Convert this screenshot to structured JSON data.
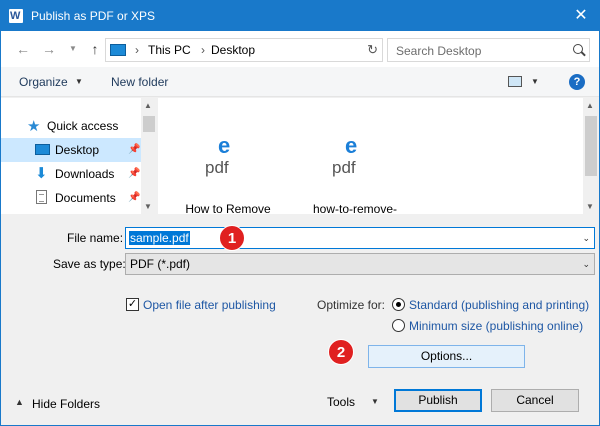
{
  "window": {
    "title": "Publish as PDF or XPS",
    "app_icon_letter": "W",
    "close_glyph": "✕"
  },
  "address": {
    "crumbs": [
      "This PC",
      "Desktop"
    ],
    "search_placeholder": "Search Desktop"
  },
  "toolbar": {
    "organize_label": "Organize",
    "new_folder_label": "New folder",
    "help_glyph": "?"
  },
  "sidebar": {
    "items": [
      {
        "label": "Quick access",
        "icon": "star-icon",
        "selected": false
      },
      {
        "label": "Desktop",
        "icon": "desktop-icon",
        "selected": true,
        "pinned": true
      },
      {
        "label": "Downloads",
        "icon": "download-icon",
        "selected": false,
        "pinned": true
      },
      {
        "label": "Documents",
        "icon": "documents-icon",
        "selected": false,
        "pinned": true
      }
    ]
  },
  "files": [
    {
      "name": "How to Remove",
      "icon_letter": "e",
      "icon_text": "pdf"
    },
    {
      "name": "how-to-remove-",
      "icon_letter": "e",
      "icon_text": "pdf"
    }
  ],
  "form": {
    "file_name_label": "File name:",
    "file_name_value": "sample.pdf",
    "save_type_label": "Save as type:",
    "save_type_value": "PDF (*.pdf)",
    "open_after_label": "Open file after publishing",
    "open_after_checked": true,
    "optimize_label": "Optimize for:",
    "optimize_standard": "Standard (publishing and printing)",
    "optimize_minimum": "Minimum size (publishing online)",
    "optimize_selected": "standard",
    "options_button": "Options...",
    "hide_folders": "Hide Folders",
    "tools": "Tools",
    "publish_button": "Publish",
    "cancel_button": "Cancel"
  },
  "annotations": {
    "badge_1": "1",
    "badge_2": "2",
    "badge_color": "#e02020"
  },
  "colors": {
    "titlebar": "#1979ca",
    "selection": "#0078d7"
  }
}
